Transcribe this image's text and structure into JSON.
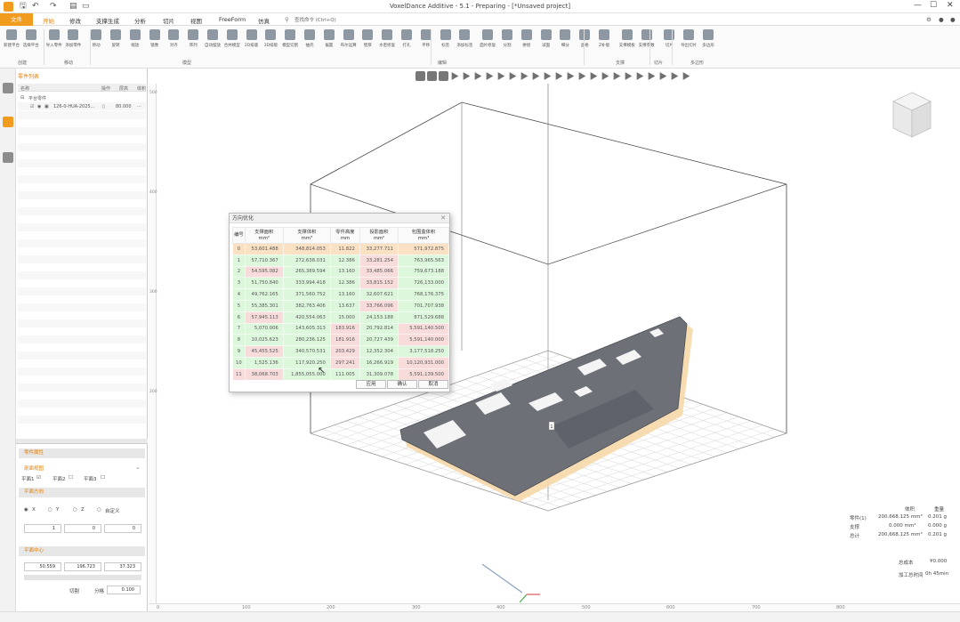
{
  "titlebar": {
    "title": "VoxelDance Additive - 5.1 - Preparing - [*Unsaved project]",
    "search_placeholder": "查找命令 (Ctrl+Q)",
    "window_buttons": [
      "—",
      "☐",
      "✕"
    ]
  },
  "menu": {
    "file": "文件",
    "items": [
      "开始",
      "修改",
      "支撑生成",
      "分析",
      "切片",
      "视图",
      "FreeForm",
      "仿真"
    ],
    "active_index": 0
  },
  "ribbon": {
    "buttons": [
      "新建平台",
      "选择平台",
      "导入零件",
      "添加零件",
      "移动",
      "旋转",
      "缩放",
      "镜像",
      "对齐",
      "阵列",
      "自动摆放",
      "合并模型",
      "2D排版",
      "3D排版",
      "模型切割",
      "抽壳",
      "偏置",
      "布尔运算",
      "壁厚",
      "水密修复",
      "打孔",
      "平移",
      "标签",
      "添加标签",
      "面片修复",
      "分割",
      "拼接",
      "减面",
      "细分",
      "晶格",
      "Z补偿",
      "支撑模板",
      "支撑参数",
      "切片",
      "导出切片",
      "多边形"
    ],
    "groups": [
      "创建",
      "移动",
      "模型",
      "编辑",
      "支撑",
      "切片",
      "多边形"
    ]
  },
  "part_panel": {
    "title": "零件列表",
    "columns": [
      "名称",
      "操作",
      "层高",
      "体积"
    ],
    "platform_row": "平台零件",
    "part_name": "126-0-HUA-2025...",
    "part_layer": "80.000",
    "part_more": "···"
  },
  "props_panel": {
    "section_title": "零件属性",
    "subsection": "剖面视图",
    "plane_options": [
      "平面1",
      "平面2",
      "平面3"
    ],
    "direction_title": "平面方向",
    "axis_options": [
      "X",
      "Y",
      "Z",
      "自定义"
    ],
    "direction_values": [
      "1",
      "0",
      "0"
    ],
    "center_title": "平面中心",
    "center_values": [
      "50.559",
      "196.723",
      "37.323"
    ],
    "step_label": "切割",
    "step_label2": "分格",
    "step_value": "0.100"
  },
  "viewport": {
    "tag": "1"
  },
  "dialog": {
    "title": "方向优化",
    "close": "✕",
    "headers": [
      [
        "编号",
        ""
      ],
      [
        "支撑面积",
        "mm²"
      ],
      [
        "支撑体积",
        "mm³"
      ],
      [
        "零件高度",
        "mm"
      ],
      [
        "投影面积",
        "mm²"
      ],
      [
        "包围盒体积",
        "mm³"
      ]
    ],
    "rows": [
      [
        "0",
        "53,601.488",
        "348,814.053",
        "11.822",
        "33,277.711",
        "571,972.875"
      ],
      [
        "1",
        "57,710.367",
        "272,638.031",
        "12.386",
        "33,281.254",
        "763,965.563"
      ],
      [
        "2",
        "54,595.082",
        "265,389.594",
        "13.160",
        "33,485.066",
        "759,673.188"
      ],
      [
        "3",
        "51,750.840",
        "333,994.418",
        "12.386",
        "33,815.152",
        "726,133.000"
      ],
      [
        "4",
        "49,762.165",
        "371,560.752",
        "13.160",
        "32,607.621",
        "768,176.375"
      ],
      [
        "5",
        "55,385.301",
        "382,763.406",
        "13.637",
        "33,766.096",
        "701,707.938"
      ],
      [
        "6",
        "57,945.113",
        "420,554.063",
        "15.000",
        "24,153.188",
        "871,529.688"
      ],
      [
        "7",
        "5,070.006",
        "143,605.313",
        "183.916",
        "20,792.814",
        "5,591,140.500"
      ],
      [
        "8",
        "10,025.623",
        "280,236.125",
        "181.916",
        "20,727.439",
        "5,591,140.000"
      ],
      [
        "9",
        "45,455.525",
        "340,570.531",
        "203.429",
        "12,352.304",
        "3,177,518.250"
      ],
      [
        "10",
        "1,525.136",
        "117,920.250",
        "297.241",
        "16,266.919",
        "10,120,931.000"
      ],
      [
        "11",
        "38,068.703",
        "1,855,055.000",
        "111.005",
        "31,309.078",
        "5,591,139.500"
      ]
    ],
    "buttons": [
      "应用",
      "确认",
      "取消"
    ]
  },
  "stats": {
    "col_headers": [
      "体积",
      "重量"
    ],
    "rows": [
      [
        "零件(1)",
        "200,668.125 mm³",
        "0.201 g"
      ],
      [
        "支撑",
        "0.000 mm³",
        "0.000 g"
      ],
      [
        "总计",
        "200,668.125 mm³",
        "0.201 g"
      ]
    ],
    "cost_label": "总成本",
    "cost_value": "¥0.000",
    "time_label": "加工总时间",
    "time_value": "0h 45min"
  },
  "ruler": {
    "x_ticks": [
      "0",
      "100",
      "200",
      "300",
      "400",
      "500",
      "600",
      "700",
      "800"
    ],
    "y_ticks": [
      "500",
      "400",
      "300",
      "200"
    ]
  },
  "colors": {
    "accent": "#f29c1f",
    "good_row": "#dcf7dc",
    "bad_row": "#f8dcdc",
    "selected_row": "#fbe1c4",
    "part": "#6e7078"
  }
}
